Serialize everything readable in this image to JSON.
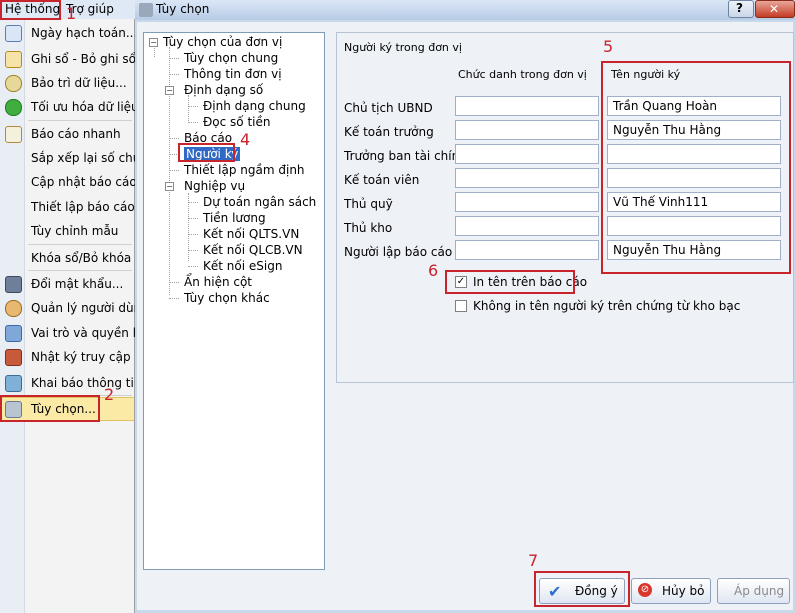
{
  "menu": {
    "top": [
      "Hệ thống",
      "Trợ giúp"
    ],
    "items": [
      {
        "label": "Ngày hạch toán...",
        "icon": "calendar-icon"
      },
      {
        "label": "Ghi sổ - Bỏ ghi sổ th",
        "icon": "ledger-icon"
      },
      {
        "label": "Bảo trì dữ liệu...",
        "icon": "maintenance-icon"
      },
      {
        "label": "Tối ưu hóa dữ liệu",
        "icon": "optimize-icon"
      },
      {
        "label": "Báo cáo nhanh",
        "icon": "report-icon"
      },
      {
        "label": "Sắp xếp lại số chứng",
        "icon": ""
      },
      {
        "label": "Cập nhật báo cáo...",
        "icon": ""
      },
      {
        "label": "Thiết lập báo cáo tà",
        "icon": ""
      },
      {
        "label": "Tùy chỉnh mẫu",
        "icon": ""
      },
      {
        "label": "Khóa sổ/Bỏ khóa sổ",
        "icon": ""
      },
      {
        "label": "Đổi mật khẩu...",
        "icon": "key-icon"
      },
      {
        "label": "Quản lý người dùng",
        "icon": "users-icon"
      },
      {
        "label": "Vai trò và quyền hạ",
        "icon": "roles-icon"
      },
      {
        "label": "Nhật ký truy cập",
        "icon": "log-icon"
      },
      {
        "label": "Khai báo thông tin l",
        "icon": "info-icon"
      },
      {
        "label": "Tùy chọn...",
        "icon": "tools-icon"
      }
    ]
  },
  "dialog": {
    "title": "Tùy chọn",
    "tree": [
      "Tùy chọn của đơn vị",
      "Tùy chọn chung",
      "Thông tin đơn vị",
      "Định dạng số",
      "Định dạng chung",
      "Đọc số tiền",
      "Báo cáo",
      "Người ký",
      "Thiết lập ngầm định",
      "Nghiệp vụ",
      "Dự toán ngân sách",
      "Tiền lương",
      "Kết nối QLTS.VN",
      "Kết nối QLCB.VN",
      "Kết nối eSign",
      "Ẩn hiện cột",
      "Tùy chọn khác"
    ],
    "section_title": "Người ký trong đơn vị",
    "col_title": "Chức danh trong đơn vị",
    "col_name": "Tên người ký",
    "rows": [
      {
        "label": "Chủ tịch UBND",
        "title": "",
        "name": "Trần Quang Hoàn"
      },
      {
        "label": "Kế toán trưởng",
        "title": "",
        "name": "Nguyễn Thu Hằng"
      },
      {
        "label": "Trưởng ban tài chính",
        "title": "",
        "name": ""
      },
      {
        "label": "Kế toán viên",
        "title": "",
        "name": ""
      },
      {
        "label": "Thủ quỹ",
        "title": "",
        "name": "Vũ Thế Vinh111"
      },
      {
        "label": "Thủ kho",
        "title": "",
        "name": ""
      },
      {
        "label": "Người lập báo cáo",
        "title": "",
        "name": "Nguyễn Thu Hằng"
      }
    ],
    "check_print": "In tên trên báo cáo",
    "check_print_checked": true,
    "check_noprint": "Không in tên người ký trên chứng từ kho bạc",
    "check_noprint_checked": false,
    "btn_ok": "Đồng ý",
    "btn_cancel": "Hủy bỏ",
    "btn_apply": "Áp dụng",
    "help_glyph": "?",
    "close_glyph": "✕"
  },
  "callouts": [
    "1",
    "2",
    "4",
    "5",
    "6",
    "7"
  ]
}
